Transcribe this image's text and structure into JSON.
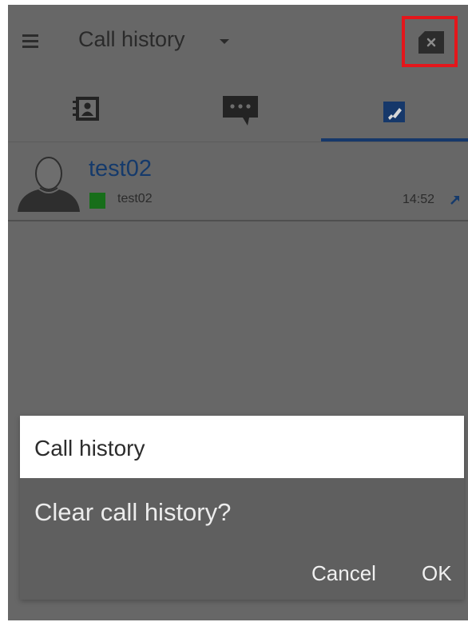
{
  "appbar": {
    "title": "Call history",
    "menu_icon": "menu-icon",
    "dropdown_icon": "dropdown-icon",
    "clear_icon": "clear-history-icon",
    "highlight_color": "#e4161b"
  },
  "tabs": [
    {
      "icon": "contacts-icon",
      "selected": false
    },
    {
      "icon": "chat-icon",
      "selected": false
    },
    {
      "icon": "call-history-icon",
      "selected": true
    }
  ],
  "call_history": [
    {
      "name": "test02",
      "subtitle": "test02",
      "time": "14:52",
      "direction": "outgoing",
      "presence_color": "#176e1a"
    }
  ],
  "dialog": {
    "title": "Call history",
    "message": "Clear call history?",
    "cancel_label": "Cancel",
    "ok_label": "OK"
  },
  "colors": {
    "accent": "#16386a",
    "overlay": "#676767"
  }
}
